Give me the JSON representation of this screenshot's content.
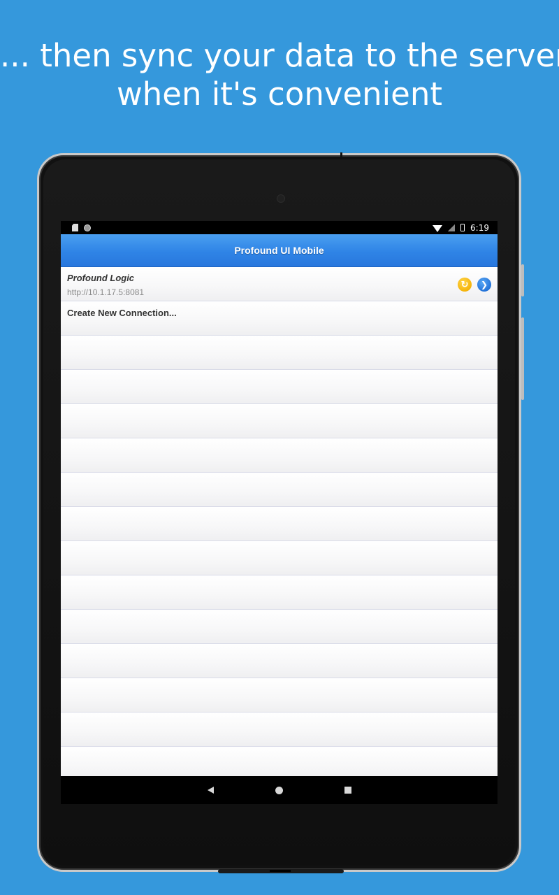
{
  "headline": {
    "line1": "... then sync your data to the server",
    "line2": "when it's convenient"
  },
  "status_bar": {
    "time": "6:19",
    "left_icons": [
      "sd-card-icon",
      "circle-notification-icon"
    ],
    "right_icons": [
      "wifi-icon",
      "signal-icon",
      "battery-icon"
    ]
  },
  "app": {
    "title": "Profound UI Mobile",
    "header_color": "#2f84e6"
  },
  "connections": [
    {
      "name": "Profound Logic",
      "url": "http://10.1.17.5:8081",
      "icons": [
        "sync-icon",
        "go-arrow-icon"
      ],
      "sync_color": "#f5b40a",
      "go_color": "#1f6fd6"
    }
  ],
  "create_label": "Create New Connection...",
  "empty_rows": 13,
  "nav": [
    "back-icon",
    "home-icon",
    "recents-icon"
  ],
  "background_color": "#3598dc"
}
